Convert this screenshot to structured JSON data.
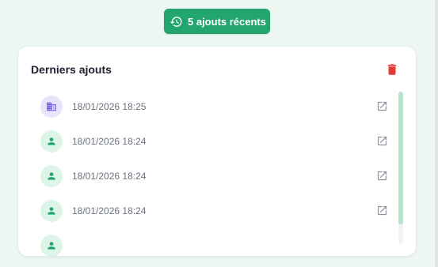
{
  "badge": {
    "label": "5 ajouts récents",
    "icon": "history-icon",
    "color": "#22a56f"
  },
  "panel": {
    "title": "Derniers ajouts",
    "clear_icon": "trash-icon",
    "items": [
      {
        "type": "building",
        "icon": "building-icon",
        "date": "18/01/2026 18:25"
      },
      {
        "type": "person",
        "icon": "person-icon",
        "date": "18/01/2026 18:24"
      },
      {
        "type": "person",
        "icon": "person-icon",
        "date": "18/01/2026 18:24"
      },
      {
        "type": "person",
        "icon": "person-icon",
        "date": "18/01/2026 18:24"
      },
      {
        "type": "person",
        "icon": "person-icon",
        "date": ""
      }
    ]
  },
  "colors": {
    "accent": "#22a56f",
    "danger": "#e53935",
    "building": "#6b5bd6"
  }
}
